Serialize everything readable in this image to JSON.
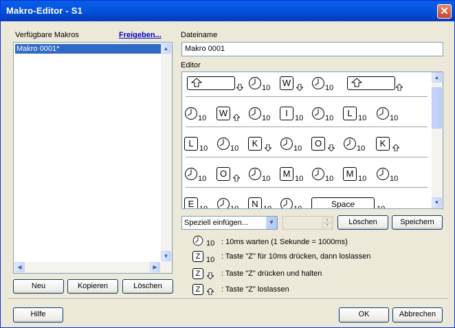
{
  "window": {
    "title": "Makro-Editor - S1",
    "close_glyph": "✕"
  },
  "left": {
    "label": "Verfügbare Makros",
    "share_link": "Freigeben...",
    "items": [
      "Makro 0001*"
    ],
    "buttons": {
      "new": "Neu",
      "copy": "Kopieren",
      "delete": "Löschen"
    }
  },
  "filename": {
    "label": "Dateiname",
    "value": "Makro 0001"
  },
  "editor": {
    "label": "Editor",
    "rows": [
      [
        {
          "t": "shiftkey"
        },
        {
          "t": "arrow",
          "d": "down"
        },
        {
          "t": "clock",
          "n": "10"
        },
        {
          "t": "key",
          "k": "W",
          "d": "down"
        },
        {
          "t": "clock",
          "n": "10"
        },
        {
          "t": "shiftkey"
        },
        {
          "t": "arrow",
          "d": "up"
        }
      ],
      [
        {
          "t": "clock",
          "n": "10"
        },
        {
          "t": "key",
          "k": "W",
          "d": "up"
        },
        {
          "t": "clock",
          "n": "10"
        },
        {
          "t": "key",
          "k": "I",
          "n": "10"
        },
        {
          "t": "clock",
          "n": "10"
        },
        {
          "t": "key",
          "k": "L",
          "n": "10"
        },
        {
          "t": "clock",
          "n": "10"
        }
      ],
      [
        {
          "t": "key",
          "k": "L",
          "n": "10"
        },
        {
          "t": "clock",
          "n": "10"
        },
        {
          "t": "key",
          "k": "K",
          "d": "down"
        },
        {
          "t": "clock",
          "n": "10"
        },
        {
          "t": "key",
          "k": "O",
          "d": "down"
        },
        {
          "t": "clock",
          "n": "10"
        },
        {
          "t": "key",
          "k": "K",
          "d": "up"
        }
      ],
      [
        {
          "t": "clock",
          "n": "10"
        },
        {
          "t": "key",
          "k": "O",
          "d": "up"
        },
        {
          "t": "clock",
          "n": "10"
        },
        {
          "t": "key",
          "k": "M",
          "n": "10"
        },
        {
          "t": "clock",
          "n": "10"
        },
        {
          "t": "key",
          "k": "M",
          "n": "10"
        },
        {
          "t": "clock",
          "n": "10"
        }
      ],
      [
        {
          "t": "key",
          "k": "E",
          "n": "10"
        },
        {
          "t": "clock",
          "n": "10"
        },
        {
          "t": "key",
          "k": "N",
          "n": "10"
        },
        {
          "t": "clock",
          "n": "10"
        },
        {
          "t": "space",
          "k": "Space",
          "n": "10"
        }
      ]
    ]
  },
  "insert": {
    "combo_value": "Speziell einfügen...",
    "delete": "Löschen",
    "save": "Speichern"
  },
  "legend": {
    "wait": ": 10ms warten (1 Sekunde = 1000ms)",
    "press_release": ": Taste \"Z\" für 10ms drücken, dann loslassen",
    "press_hold": ": Taste \"Z\" drücken und halten",
    "release": ": Taste \"Z\" loslassen",
    "key": "Z",
    "num": "10"
  },
  "footer": {
    "help": "Hilfe",
    "ok": "OK",
    "cancel": "Abbrechen"
  }
}
